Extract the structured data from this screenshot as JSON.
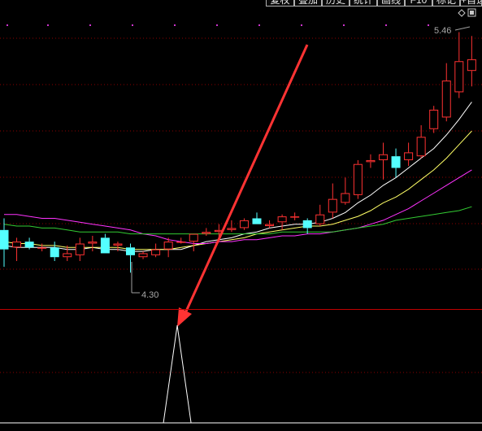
{
  "toolbar": {
    "buttons": [
      "复权",
      "叠加",
      "历史",
      "统计",
      "画线",
      "F10",
      "标记",
      "+自选"
    ]
  },
  "price_labels": {
    "high": "5.46",
    "low": "4.30"
  },
  "colors": {
    "background": "#000000",
    "grid": "#8b0000",
    "up_candle": "#ff3232",
    "down_candle": "#54ffff",
    "ma_white": "#ffffff",
    "ma_yellow": "#ffff66",
    "ma_magenta": "#ff33ff",
    "ma_green": "#33cc33",
    "arrow": "#ff3333",
    "indicator": "#ffffff"
  },
  "chart_data": {
    "type": "candlestick",
    "price_range": [
      4.15,
      5.55
    ],
    "candles": [
      {
        "o": 4.44,
        "h": 4.5,
        "l": 4.25,
        "c": 4.34
      },
      {
        "o": 4.35,
        "h": 4.4,
        "l": 4.28,
        "c": 4.38
      },
      {
        "o": 4.38,
        "h": 4.4,
        "l": 4.34,
        "c": 4.35
      },
      {
        "o": 4.35,
        "h": 4.37,
        "l": 4.33,
        "c": 4.35
      },
      {
        "o": 4.35,
        "h": 4.38,
        "l": 4.28,
        "c": 4.3
      },
      {
        "o": 4.3,
        "h": 4.36,
        "l": 4.28,
        "c": 4.32
      },
      {
        "o": 4.31,
        "h": 4.4,
        "l": 4.28,
        "c": 4.37
      },
      {
        "o": 4.37,
        "h": 4.41,
        "l": 4.33,
        "c": 4.38
      },
      {
        "o": 4.4,
        "h": 4.42,
        "l": 4.32,
        "c": 4.32
      },
      {
        "o": 4.36,
        "h": 4.38,
        "l": 4.33,
        "c": 4.37
      },
      {
        "o": 4.35,
        "h": 4.37,
        "l": 4.22,
        "c": 4.31
      },
      {
        "o": 4.3,
        "h": 4.33,
        "l": 4.29,
        "c": 4.32
      },
      {
        "o": 4.31,
        "h": 4.37,
        "l": 4.3,
        "c": 4.34
      },
      {
        "o": 4.34,
        "h": 4.4,
        "l": 4.3,
        "c": 4.38
      },
      {
        "o": 4.38,
        "h": 4.4,
        "l": 4.37,
        "c": 4.38
      },
      {
        "o": 4.38,
        "h": 4.42,
        "l": 4.33,
        "c": 4.42
      },
      {
        "o": 4.42,
        "h": 4.45,
        "l": 4.41,
        "c": 4.43
      },
      {
        "o": 4.43,
        "h": 4.47,
        "l": 4.4,
        "c": 4.44
      },
      {
        "o": 4.44,
        "h": 4.49,
        "l": 4.43,
        "c": 4.45
      },
      {
        "o": 4.45,
        "h": 4.5,
        "l": 4.44,
        "c": 4.49
      },
      {
        "o": 4.5,
        "h": 4.53,
        "l": 4.47,
        "c": 4.47
      },
      {
        "o": 4.46,
        "h": 4.49,
        "l": 4.45,
        "c": 4.47
      },
      {
        "o": 4.48,
        "h": 4.52,
        "l": 4.44,
        "c": 4.51
      },
      {
        "o": 4.51,
        "h": 4.53,
        "l": 4.49,
        "c": 4.51
      },
      {
        "o": 4.49,
        "h": 4.5,
        "l": 4.42,
        "c": 4.45
      },
      {
        "o": 4.47,
        "h": 4.57,
        "l": 4.46,
        "c": 4.52
      },
      {
        "o": 4.53,
        "h": 4.68,
        "l": 4.5,
        "c": 4.6
      },
      {
        "o": 4.58,
        "h": 4.71,
        "l": 4.57,
        "c": 4.63
      },
      {
        "o": 4.62,
        "h": 4.8,
        "l": 4.6,
        "c": 4.78
      },
      {
        "o": 4.79,
        "h": 4.83,
        "l": 4.76,
        "c": 4.8
      },
      {
        "o": 4.8,
        "h": 4.89,
        "l": 4.7,
        "c": 4.83
      },
      {
        "o": 4.82,
        "h": 4.86,
        "l": 4.71,
        "c": 4.76
      },
      {
        "o": 4.8,
        "h": 4.89,
        "l": 4.77,
        "c": 4.84
      },
      {
        "o": 4.82,
        "h": 4.98,
        "l": 4.81,
        "c": 4.92
      },
      {
        "o": 4.96,
        "h": 5.08,
        "l": 4.94,
        "c": 5.06
      },
      {
        "o": 5.02,
        "h": 5.3,
        "l": 5.0,
        "c": 5.21
      },
      {
        "o": 5.15,
        "h": 5.46,
        "l": 5.12,
        "c": 5.31
      },
      {
        "o": 5.26,
        "h": 5.44,
        "l": 5.18,
        "c": 5.32
      }
    ],
    "ma": [
      {
        "color": "white",
        "values": [
          4.36,
          4.35,
          4.35,
          4.35,
          4.35,
          4.34,
          4.34,
          4.35,
          4.34,
          4.34,
          4.33,
          4.33,
          4.34,
          4.34,
          4.34,
          4.36,
          4.38,
          4.39,
          4.4,
          4.42,
          4.43,
          4.45,
          4.46,
          4.47,
          4.47,
          4.48,
          4.5,
          4.53,
          4.58,
          4.62,
          4.67,
          4.71,
          4.76,
          4.81,
          4.86,
          4.93,
          5.01,
          5.1
        ]
      },
      {
        "color": "yellow",
        "values": [
          4.38,
          4.37,
          4.37,
          4.36,
          4.36,
          4.35,
          4.35,
          4.35,
          4.35,
          4.35,
          4.34,
          4.34,
          4.34,
          4.34,
          4.35,
          4.36,
          4.37,
          4.38,
          4.39,
          4.4,
          4.42,
          4.43,
          4.44,
          4.45,
          4.46,
          4.46,
          4.47,
          4.49,
          4.51,
          4.54,
          4.58,
          4.61,
          4.65,
          4.7,
          4.75,
          4.81,
          4.88,
          4.95
        ]
      },
      {
        "color": "magenta",
        "values": [
          4.52,
          4.52,
          4.51,
          4.5,
          4.5,
          4.49,
          4.48,
          4.47,
          4.46,
          4.45,
          4.44,
          4.42,
          4.41,
          4.39,
          4.38,
          4.37,
          4.37,
          4.38,
          4.38,
          4.39,
          4.39,
          4.4,
          4.41,
          4.41,
          4.42,
          4.42,
          4.43,
          4.44,
          4.45,
          4.47,
          4.49,
          4.52,
          4.55,
          4.59,
          4.63,
          4.67,
          4.71,
          4.75
        ]
      },
      {
        "color": "green",
        "values": [
          4.47,
          4.46,
          4.46,
          4.45,
          4.45,
          4.44,
          4.43,
          4.43,
          4.43,
          4.43,
          4.42,
          4.42,
          4.42,
          4.42,
          4.42,
          4.42,
          4.42,
          4.42,
          4.42,
          4.42,
          4.42,
          4.42,
          4.43,
          4.43,
          4.43,
          4.43,
          4.43,
          4.44,
          4.45,
          4.46,
          4.47,
          4.49,
          4.5,
          4.51,
          4.52,
          4.53,
          4.54,
          4.56
        ]
      }
    ],
    "indicator": {
      "spike_index": 11,
      "spike_value": 1
    }
  }
}
